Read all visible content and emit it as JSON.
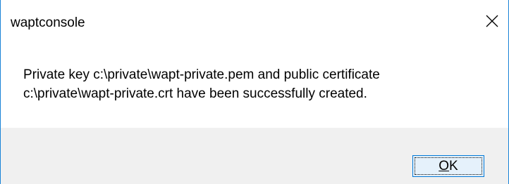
{
  "window": {
    "title": "waptconsole",
    "close_icon": "close-icon"
  },
  "message": {
    "line1": "Private key c:\\private\\wapt-private.pem and public certificate",
    "line2": "c:\\private\\wapt-private.crt have been successfully created."
  },
  "buttons": {
    "ok_accel": "O",
    "ok_rest": "K"
  },
  "colors": {
    "border_accent": "#1883d7",
    "button_face": "#e5f1fb",
    "button_border": "#0078d7",
    "footer_bg": "#f0f0f0"
  }
}
